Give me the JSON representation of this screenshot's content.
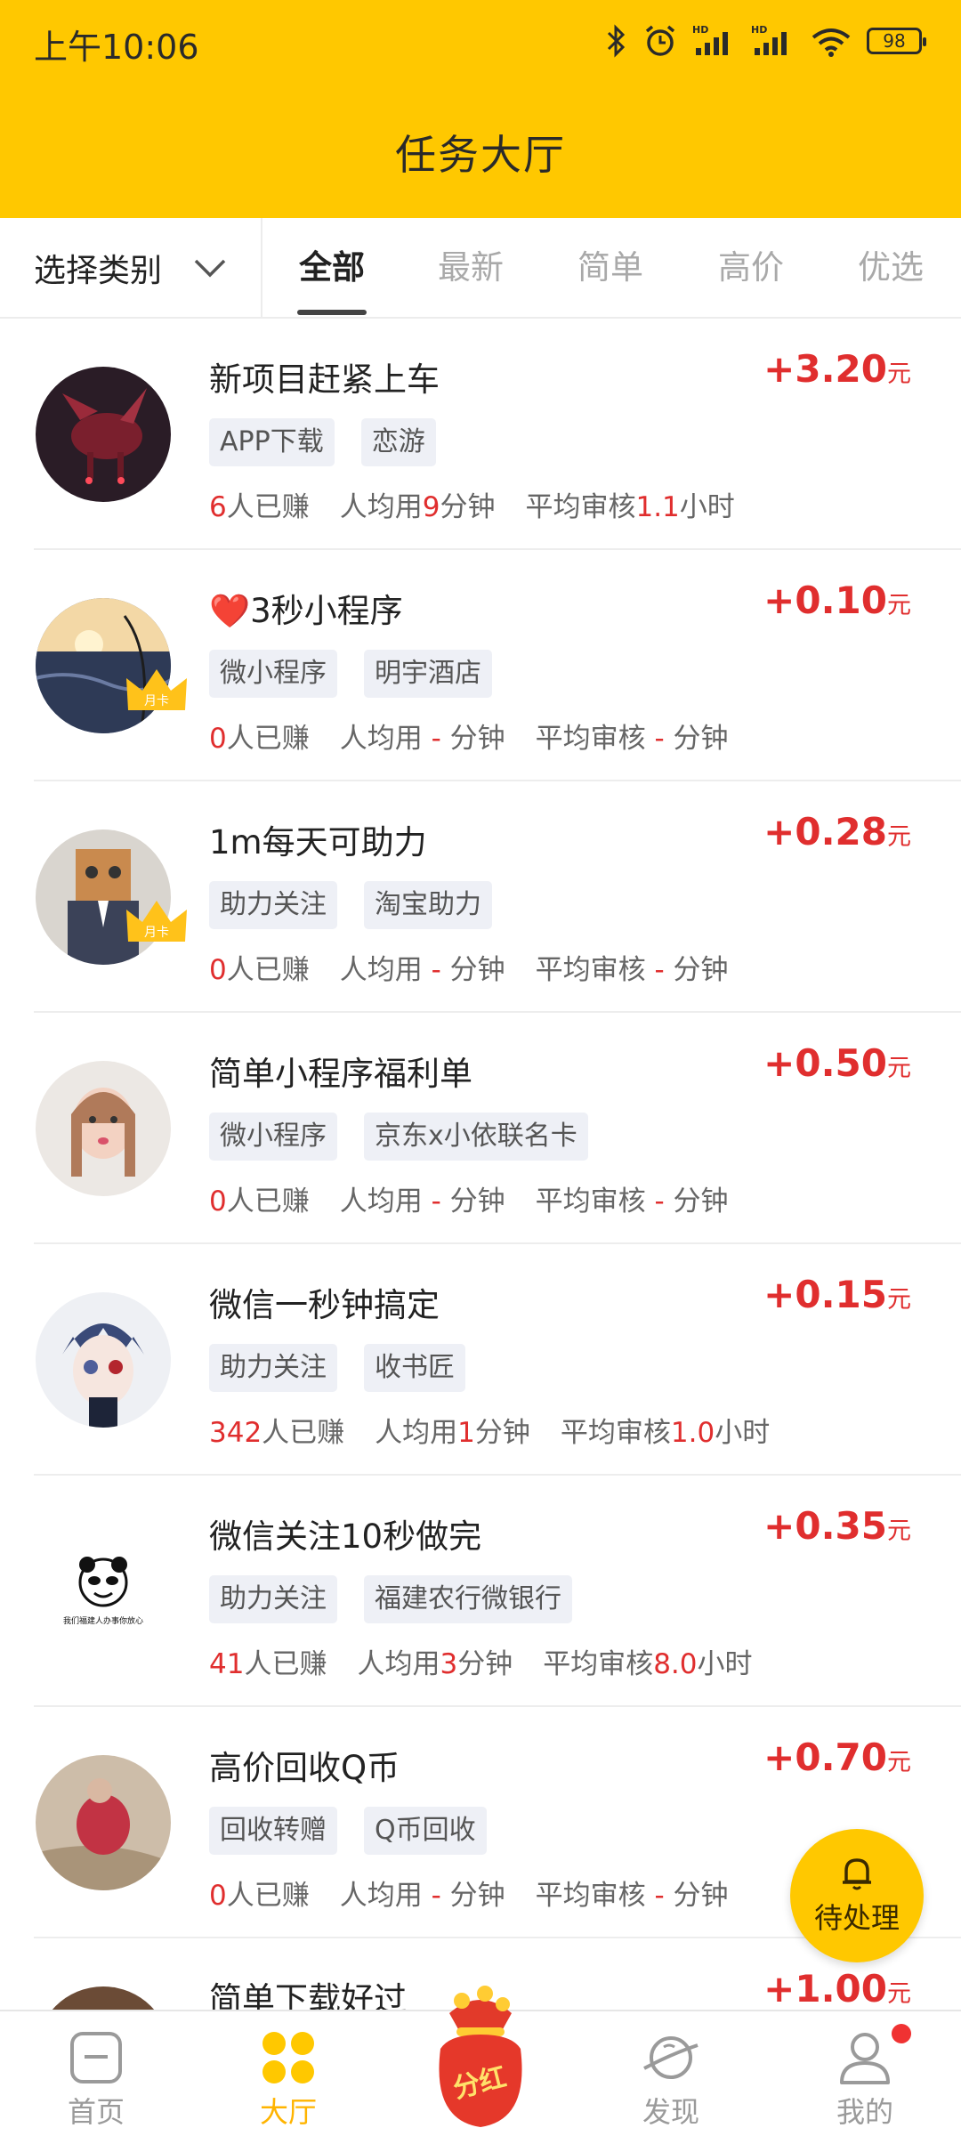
{
  "status_bar": {
    "time": "上午10:06",
    "battery": "98"
  },
  "header": {
    "title": "任务大厅"
  },
  "filter": {
    "category_label": "选择类别",
    "tabs": [
      "全部",
      "最新",
      "简单",
      "高价",
      "优选"
    ],
    "active_tab": "全部"
  },
  "tasks": [
    {
      "title": "新项目赶紧上车",
      "price": "+3.20",
      "unit": "元",
      "tags": [
        "APP下载",
        "恋游"
      ],
      "earned": "6",
      "earned_suffix": "人已赚",
      "avg_prefix": "人均用",
      "avg_time": "9",
      "avg_suffix": "分钟",
      "review_prefix": "平均审核",
      "review_time": "1.1",
      "review_suffix": "小时",
      "member_badge": ""
    },
    {
      "title": "❤️3秒小程序",
      "price": "+0.10",
      "unit": "元",
      "tags": [
        "微小程序",
        "明宇酒店"
      ],
      "earned": "0",
      "earned_suffix": "人已赚",
      "avg_prefix": "人均用",
      "avg_time": " - ",
      "avg_suffix": "分钟",
      "review_prefix": "平均审核",
      "review_time": " - ",
      "review_suffix": "分钟",
      "member_badge": "月卡"
    },
    {
      "title": "1m每天可助力",
      "price": "+0.28",
      "unit": "元",
      "tags": [
        "助力关注",
        "淘宝助力"
      ],
      "earned": "0",
      "earned_suffix": "人已赚",
      "avg_prefix": "人均用",
      "avg_time": " - ",
      "avg_suffix": "分钟",
      "review_prefix": "平均审核",
      "review_time": " - ",
      "review_suffix": "分钟",
      "member_badge": "月卡"
    },
    {
      "title": "简单小程序福利单",
      "price": "+0.50",
      "unit": "元",
      "tags": [
        "微小程序",
        "京东x小依联名卡"
      ],
      "earned": "0",
      "earned_suffix": "人已赚",
      "avg_prefix": "人均用",
      "avg_time": " - ",
      "avg_suffix": "分钟",
      "review_prefix": "平均审核",
      "review_time": " - ",
      "review_suffix": "分钟",
      "member_badge": ""
    },
    {
      "title": "微信一秒钟搞定",
      "price": "+0.15",
      "unit": "元",
      "tags": [
        "助力关注",
        "收书匠"
      ],
      "earned": "342",
      "earned_suffix": "人已赚",
      "avg_prefix": "人均用",
      "avg_time": "1",
      "avg_suffix": "分钟",
      "review_prefix": "平均审核",
      "review_time": "1.0",
      "review_suffix": "小时",
      "member_badge": ""
    },
    {
      "title": "微信关注10秒做完",
      "price": "+0.35",
      "unit": "元",
      "tags": [
        "助力关注",
        "福建农行微银行"
      ],
      "earned": "41",
      "earned_suffix": "人已赚",
      "avg_prefix": "人均用",
      "avg_time": "3",
      "avg_suffix": "分钟",
      "review_prefix": "平均审核",
      "review_time": "8.0",
      "review_suffix": "小时",
      "member_badge": "",
      "avatar_caption": "我们福建人办事你放心"
    },
    {
      "title": "高价回收Q币",
      "price": "+0.70",
      "unit": "元",
      "tags": [
        "回收转赠",
        "Q币回收"
      ],
      "earned": "0",
      "earned_suffix": "人已赚",
      "avg_prefix": "人均用",
      "avg_time": " - ",
      "avg_suffix": "分钟",
      "review_prefix": "平均审核",
      "review_time": " - ",
      "review_suffix": "分钟",
      "member_badge": ""
    },
    {
      "title": "简单下载好过",
      "price": "+1.00",
      "unit": "元",
      "tags": [],
      "earned": "",
      "member_badge": ""
    }
  ],
  "floating_button": {
    "label": "待处理"
  },
  "bottom_nav": {
    "items": [
      {
        "label": "首页",
        "icon": "home-icon"
      },
      {
        "label": "大厅",
        "icon": "hall-icon"
      },
      {
        "label": "分红",
        "icon": "dividend-bag-icon"
      },
      {
        "label": "发现",
        "icon": "planet-icon"
      },
      {
        "label": "我的",
        "icon": "user-icon"
      }
    ],
    "active": "大厅"
  },
  "colors": {
    "brand": "#ffc800",
    "price": "#e02e2e",
    "active_nav": "#ffb400"
  }
}
